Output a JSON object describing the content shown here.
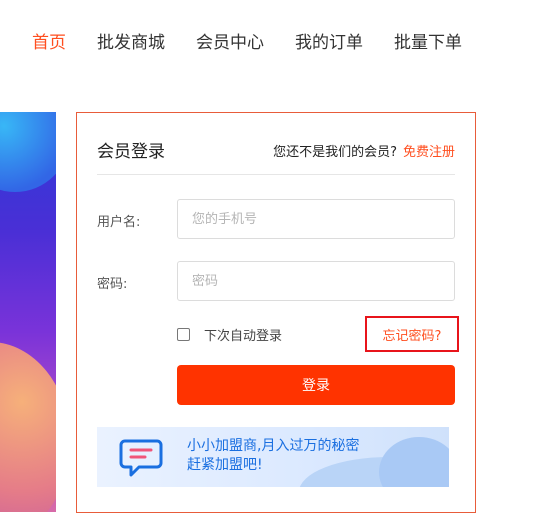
{
  "nav": {
    "items": [
      {
        "label": "首页",
        "active": true
      },
      {
        "label": "批发商城",
        "active": false
      },
      {
        "label": "会员中心",
        "active": false
      },
      {
        "label": "我的订单",
        "active": false
      },
      {
        "label": "批量下单",
        "active": false
      }
    ]
  },
  "login": {
    "title": "会员登录",
    "not_member_text": "您还不是我们的会员?",
    "register_link": "免费注册",
    "username_label": "用户名:",
    "username_placeholder": "您的手机号",
    "username_value": "",
    "password_label": "密码:",
    "password_placeholder": "密码",
    "password_value": "",
    "remember_label": "下次自动登录",
    "remember_checked": false,
    "forgot_link": "忘记密码?",
    "submit_label": "登录"
  },
  "promo": {
    "line1": "小小加盟商,月入过万的秘密",
    "line2": "赶紧加盟吧!",
    "icon": "chat-icon"
  },
  "colors": {
    "accent": "#ff4e1f",
    "button": "#ff3300",
    "card_border": "#e85c3a",
    "highlight_box": "#e8141b",
    "promo_text": "#1a6fe0"
  }
}
